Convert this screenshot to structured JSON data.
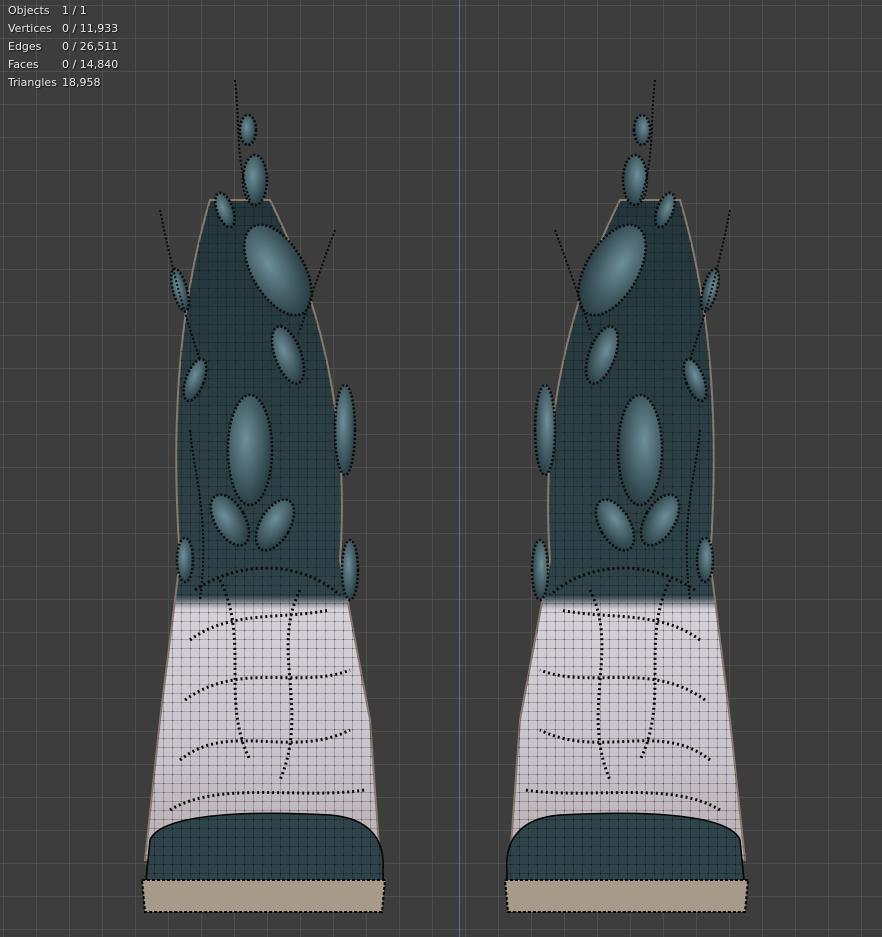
{
  "viewport": {
    "stats": [
      {
        "label": "Objects",
        "value": "1 / 1"
      },
      {
        "label": "Vertices",
        "value": "0 / 11,933"
      },
      {
        "label": "Edges",
        "value": "0 / 26,511"
      },
      {
        "label": "Faces",
        "value": "0 / 14,840"
      },
      {
        "label": "Triangles",
        "value": "18,958"
      }
    ]
  },
  "colors": {
    "background": "#3d3d3d",
    "grid": "#505050",
    "axis": "#4d6db5",
    "boot_dark": "#2b3d43",
    "boot_light": "#cfc8d0",
    "gem": "#3f5c66",
    "wire": "#111111"
  }
}
